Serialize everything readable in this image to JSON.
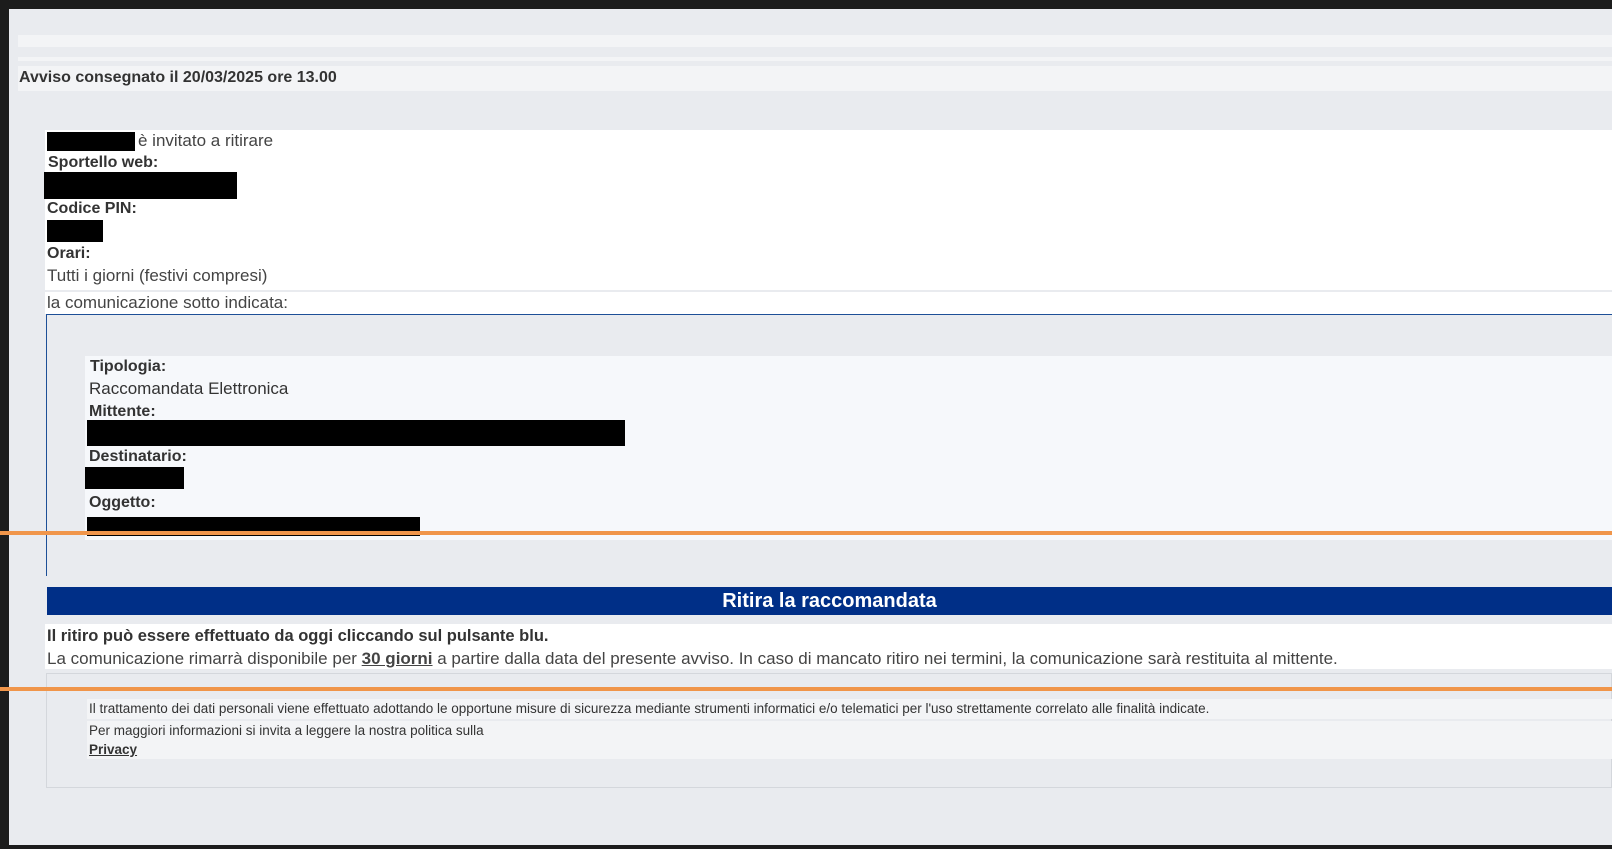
{
  "header": {
    "delivered_notice": "Avviso consegnato il 20/03/2025 ore 13.00"
  },
  "invite": {
    "invited_text": "è invitato a ritirare",
    "web_desk_label": "Sportello web:",
    "pin_label": "Codice PIN:",
    "hours_label": "Orari:",
    "hours_value": "Tutti i giorni (festivi compresi)",
    "communication_intro": "la comunicazione sotto indicata:"
  },
  "details": {
    "type_label": "Tipologia:",
    "type_value": "Raccomandata Elettronica",
    "sender_label": "Mittente:",
    "recipient_label": "Destinatario:",
    "subject_label": "Oggetto:"
  },
  "action": {
    "button_label": "Ritira la raccomandata",
    "button_color": "#002f87"
  },
  "notes": {
    "pickup_info": "Il ritiro può essere effettuato da oggi cliccando sul pulsante blu.",
    "availability_prefix": "La comunicazione rimarrà disponibile per ",
    "availability_days": "30 giorni",
    "availability_suffix": " a partire dalla data del presente avviso. In caso di mancato ritiro nei termini, la comunicazione sarà restituita al mittente."
  },
  "footer": {
    "privacy_statement": "Il trattamento dei dati personali viene effettuato adottando le opportune misure di sicurezza mediante strumenti informatici e/o telematici per l'uso strettamente correlato alle finalità indicate.",
    "more_info": "Per maggiori informazioni si invita a leggere la nostra politica sulla",
    "privacy_link": "Privacy"
  },
  "colors": {
    "annotation_line": "#f0954a"
  }
}
